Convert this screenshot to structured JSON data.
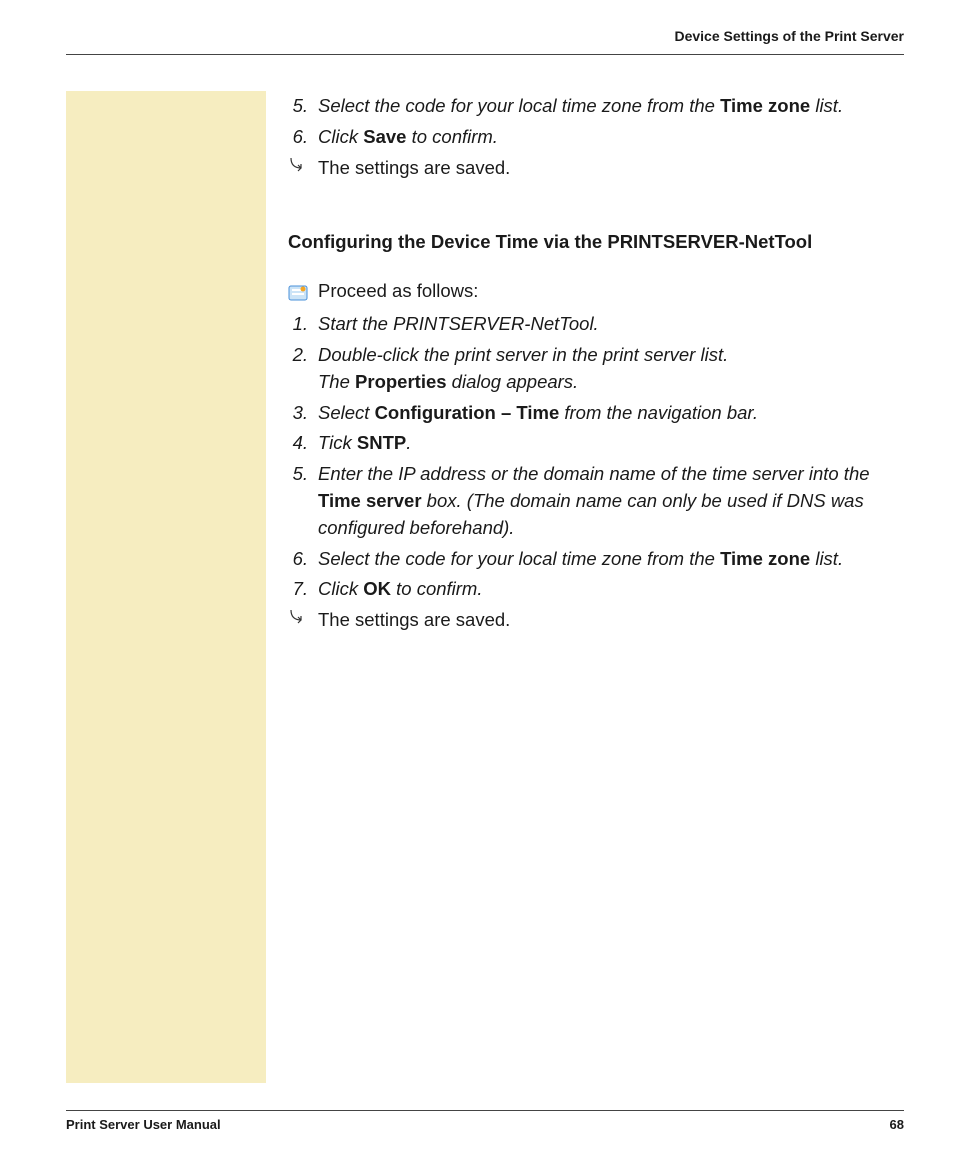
{
  "header": {
    "title": "Device Settings of the Print Server"
  },
  "top_list": {
    "items": [
      {
        "num": "5.",
        "pre": "Select the code for your local time zone from the ",
        "bold": "Time zone",
        "post": " list."
      },
      {
        "num": "6.",
        "pre": "Click ",
        "bold": "Save",
        "post": " to confirm."
      }
    ],
    "result": "The settings are saved."
  },
  "section": {
    "title": "Configuring the Device Time via the PRINTSERVER-NetTool",
    "proceed": "Proceed as follows:",
    "items": [
      {
        "num": "1.",
        "pre": "Start the PRINTSERVER-NetTool.",
        "bold": "",
        "post": ""
      },
      {
        "num": "2.",
        "pre": "Double-click the print server in the print server list.",
        "line2_pre": "The ",
        "line2_bold": "Properties",
        "line2_post": " dialog appears."
      },
      {
        "num": "3.",
        "pre": "Select ",
        "bold": "Configuration – Time",
        "post": " from the navigation bar."
      },
      {
        "num": "4.",
        "pre": "Tick ",
        "bold": "SNTP",
        "post": "."
      },
      {
        "num": "5.",
        "pre": "Enter the IP address or the domain name of the time server into the ",
        "bold": "Time server",
        "post": " box. (The domain name can only be used if DNS was configured beforehand)."
      },
      {
        "num": "6.",
        "pre": "Select the code for your local time zone from the ",
        "bold": "Time zone",
        "post": " list."
      },
      {
        "num": "7.",
        "pre": "Click ",
        "bold": "OK",
        "post": " to confirm."
      }
    ],
    "result": "The settings are saved."
  },
  "footer": {
    "left": "Print Server User Manual",
    "page": "68"
  }
}
